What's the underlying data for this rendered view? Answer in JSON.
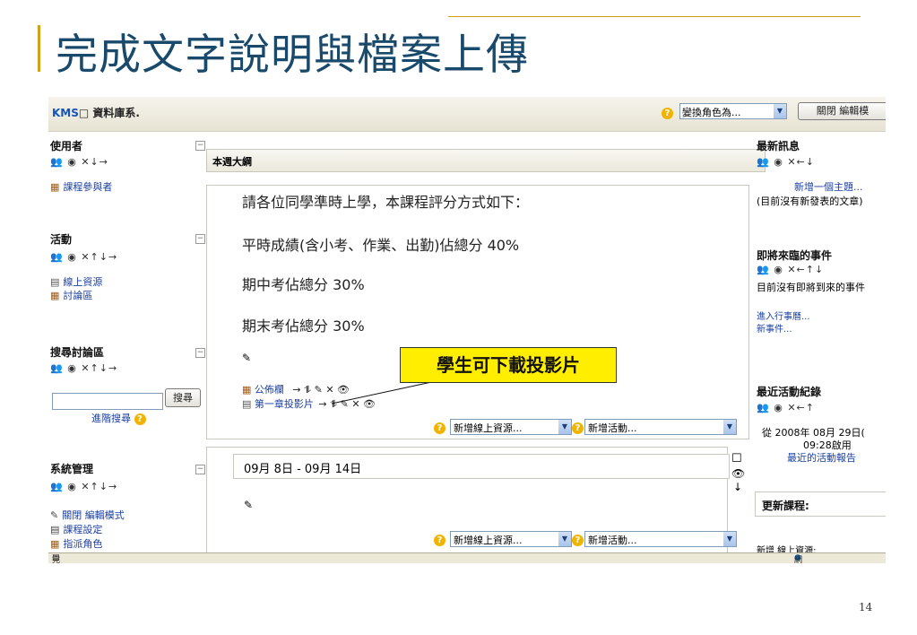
{
  "slide": {
    "title": "完成文字說明與檔案上傳",
    "page_number": "14",
    "callout": "學生可下載投影片",
    "accent_color": "#d4a017",
    "title_color": "#1a4a6b",
    "callout_color": "#ffee00"
  },
  "browser": {
    "site_title_kms": "KMS",
    "site_title_rest": "□ 資料庫系.",
    "role_label": "變換角色為...",
    "edit_button": "關閉 編輯模",
    "status_left": "完成",
    "status_right": "網際網路"
  },
  "icons": {
    "edit_row_arrows": "✕↓→",
    "edit_row_updown": "✕↑↓→",
    "edit_row_news": "✕←↓",
    "edit_row_events": "✕←↑↓",
    "edit_row_recent": "✕←↑",
    "module_actions": "→ ⥮ ✎ ✕ 👁",
    "help": "?"
  },
  "left": {
    "users": {
      "title": "使用者",
      "items": [
        "課程參與者"
      ]
    },
    "activities": {
      "title": "活動",
      "items": [
        "線上資源",
        "討論區"
      ]
    },
    "forum_search": {
      "title": "搜尋討論區",
      "button": "搜尋",
      "advanced": "進階搜尋"
    },
    "admin": {
      "title": "系統管理",
      "items": [
        "關閉 編輯模式",
        "課程設定",
        "指派角色"
      ]
    }
  },
  "center": {
    "outline_title": "本週大綱",
    "lines": [
      "請各位同學準時上學，本課程評分方式如下：",
      "平時成績(含小考、作業、出勤)佔總分 40%",
      "期中考佔總分 30%",
      "期末考佔總分 30%"
    ],
    "modules": [
      "公佈欄",
      "第一章投影片"
    ],
    "add_resource": "新增線上資源...",
    "add_activity": "新增活動...",
    "week2_title": "09月 8日 - 09月 14日"
  },
  "right": {
    "news": {
      "title": "最新訊息",
      "add": "新增一個主題...",
      "empty": "(目前沒有新發表的文章)"
    },
    "events": {
      "title": "即將來臨的事件",
      "empty": "目前沒有即將到來的事件",
      "goto": "進入行事曆...",
      "new_event": "新事件..."
    },
    "recent": {
      "title": "最近活動紀錄",
      "since": "從 2008年 08月 29日(",
      "time": "09:28啟用",
      "report": "最近的活動報告"
    },
    "course_update": {
      "title": "更新課程:",
      "partial": "新增 線上資源:"
    }
  }
}
